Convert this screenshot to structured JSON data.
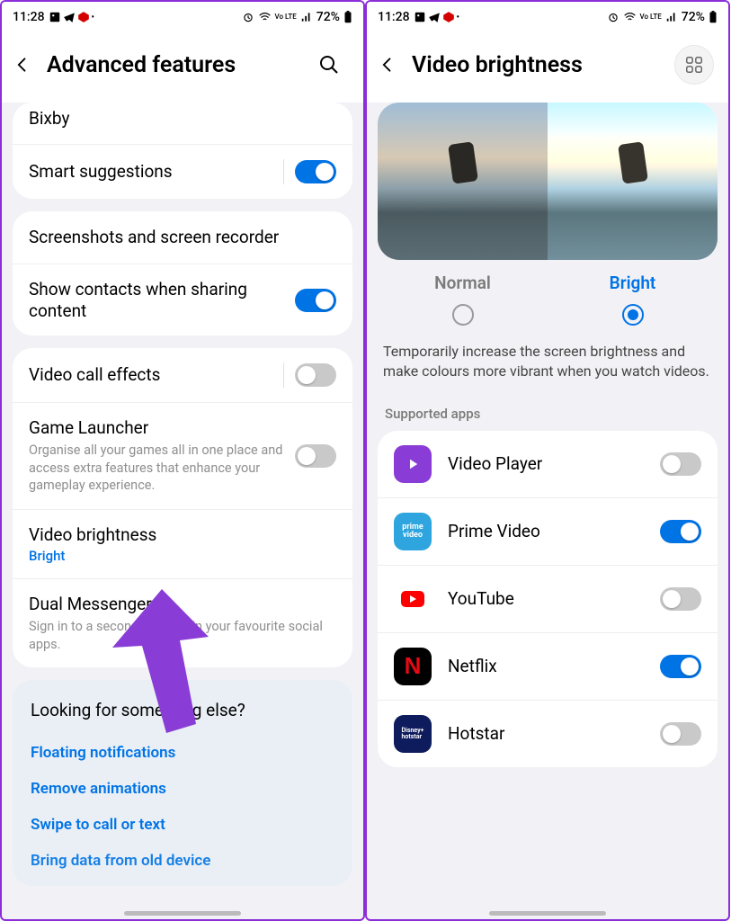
{
  "status": {
    "time": "11:28",
    "battery_text": "72%",
    "network_text": "Vo LTE",
    "icons_left": [
      "picture-icon",
      "telegram-icon",
      "hex-icon",
      "dot-icon"
    ],
    "icons_right": [
      "alarm-icon",
      "wifi-icon",
      "volte-icon",
      "signal-icon"
    ]
  },
  "left": {
    "title": "Advanced features",
    "rows": {
      "bixby": "Bixby",
      "smart_suggestions": "Smart suggestions",
      "screenshots": "Screenshots and screen recorder",
      "show_contacts": "Show contacts when sharing content",
      "video_call": "Video call effects",
      "game_launcher": "Game Launcher",
      "game_launcher_sub": "Organise all your games all in one place and access extra features that enhance your gameplay experience.",
      "video_brightness": "Video brightness",
      "video_brightness_value": "Bright",
      "dual_messenger": "Dual Messenger",
      "dual_messenger_sub": "Sign in to a second account in your favourite social apps."
    },
    "looking": {
      "title": "Looking for something else?",
      "links": [
        "Floating notifications",
        "Remove animations",
        "Swipe to call or text",
        "Bring data from old device"
      ]
    }
  },
  "right": {
    "title": "Video brightness",
    "options": {
      "normal": "Normal",
      "bright": "Bright"
    },
    "desc": "Temporarily increase the screen brightness and make colours more vibrant when you watch videos.",
    "supported_title": "Supported apps",
    "apps": [
      {
        "name": "Video Player",
        "on": false,
        "color": "#8a3dd6",
        "icon": "play"
      },
      {
        "name": "Prime Video",
        "on": true,
        "color": "#2fa5e0",
        "icon": "prime"
      },
      {
        "name": "YouTube",
        "on": false,
        "color": "#ffffff",
        "icon": "youtube"
      },
      {
        "name": "Netflix",
        "on": true,
        "color": "#000000",
        "icon": "netflix"
      },
      {
        "name": "Hotstar",
        "on": false,
        "color": "#0e1b5c",
        "icon": "hotstar"
      }
    ]
  }
}
